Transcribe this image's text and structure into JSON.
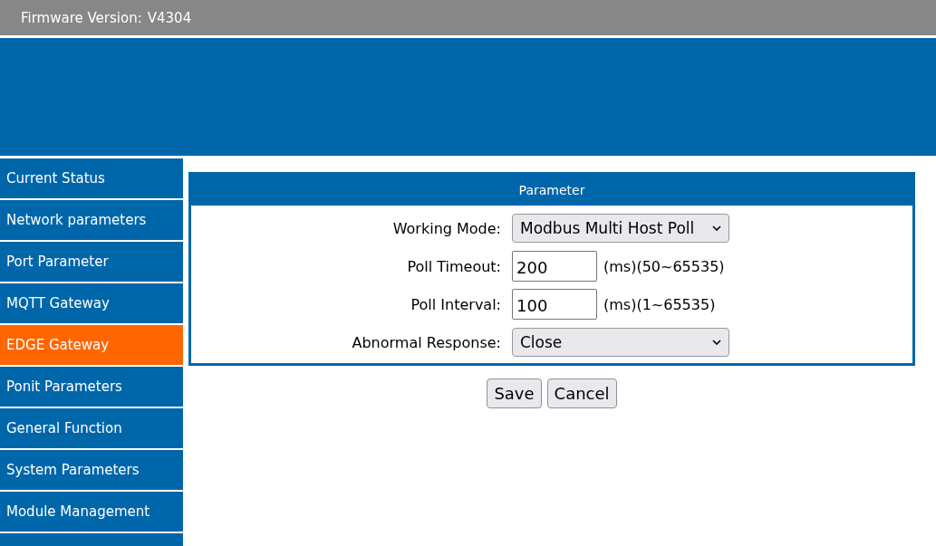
{
  "header": {
    "firmware_label": "Firmware Version:",
    "firmware_version": "V4304"
  },
  "sidebar": {
    "items": [
      {
        "label": "Current Status",
        "selected": false
      },
      {
        "label": "Network parameters",
        "selected": false
      },
      {
        "label": "Port Parameter",
        "selected": false
      },
      {
        "label": "MQTT Gateway",
        "selected": false
      },
      {
        "label": "EDGE Gateway",
        "selected": true
      },
      {
        "label": "Ponit Parameters",
        "selected": false
      },
      {
        "label": "General Function",
        "selected": false
      },
      {
        "label": "System Parameters",
        "selected": false
      },
      {
        "label": "Module Management",
        "selected": false
      }
    ]
  },
  "panel": {
    "title": "Parameter",
    "fields": [
      {
        "kind": "select",
        "label": "Working Mode:",
        "value": "Modbus Multi Host Poll"
      },
      {
        "kind": "text",
        "label": "Poll Timeout:",
        "value": "200",
        "hint": "(ms)(50~65535)"
      },
      {
        "kind": "text",
        "label": "Poll Interval:",
        "value": "100",
        "hint": "(ms)(1~65535)"
      },
      {
        "kind": "select",
        "label": "Abnormal Response:",
        "value": "Close"
      }
    ]
  },
  "buttons": [
    "Save",
    "Cancel"
  ]
}
